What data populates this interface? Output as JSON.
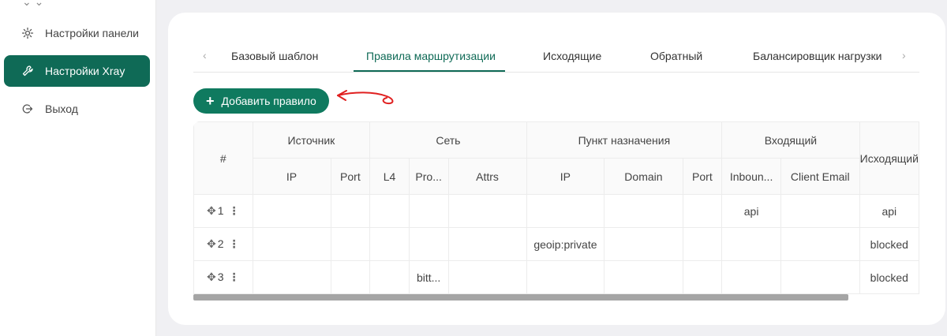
{
  "sidebar": {
    "items": [
      {
        "label": "Настройки панели",
        "icon": "gear-icon"
      },
      {
        "label": "Настройки Xray",
        "icon": "wrench-icon",
        "active": true
      },
      {
        "label": "Выход",
        "icon": "logout-icon"
      }
    ]
  },
  "tabs": {
    "items": [
      "Базовый шаблон",
      "Правила маршрутизации",
      "Исходящие",
      "Обратный",
      "Балансировщик нагрузки"
    ],
    "active_index": 1
  },
  "add_button": {
    "label": "Добавить правило",
    "icon": "plus-icon"
  },
  "table": {
    "group_headers": {
      "index": "#",
      "source": "Источник",
      "network": "Сеть",
      "destination": "Пункт назначения",
      "inbound": "Входящий",
      "outbound": "Исходящий"
    },
    "sub_headers": {
      "source_ip": "IP",
      "source_port": "Port",
      "net_l4": "L4",
      "net_protocol": "Pro...",
      "net_attrs": "Attrs",
      "dest_ip": "IP",
      "dest_domain": "Domain",
      "dest_port": "Port",
      "inbound_tag": "Inboun...",
      "client_email": "Client Email"
    },
    "rows": [
      {
        "index": "1",
        "protocol": "",
        "dest_ip": "",
        "inbound": "api",
        "outbound": "api"
      },
      {
        "index": "2",
        "protocol": "",
        "dest_ip": "geoip:private",
        "inbound": "",
        "outbound": "blocked"
      },
      {
        "index": "3",
        "protocol": "bitt...",
        "dest_ip": "",
        "inbound": "",
        "outbound": "blocked"
      }
    ]
  },
  "colors": {
    "accent": "#0f6a56",
    "button": "#0f7a5f",
    "annotation": "#e02020"
  }
}
